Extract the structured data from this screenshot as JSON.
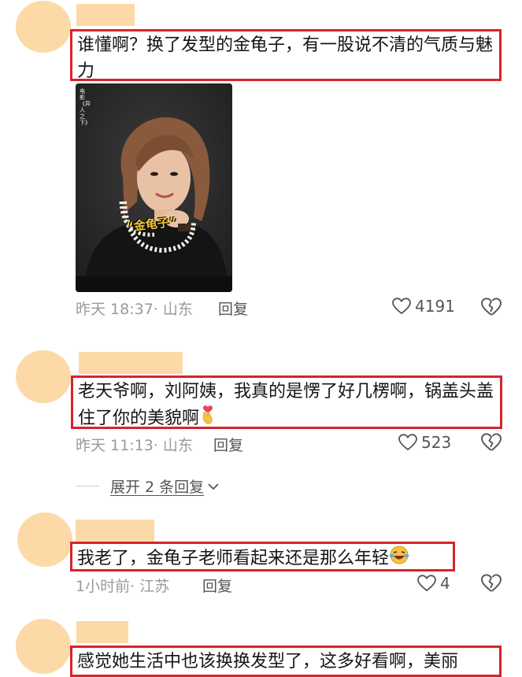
{
  "comments": [
    {
      "text": "谁懂啊？换了发型的金龟子，有一股说不清的气质与魅力",
      "time": "昨天 18:37",
      "location": "山东",
      "reply_label": "回复",
      "likes": "4191",
      "image": {
        "caption": "“金龟子”",
        "vertical_text": "电影《异人之下》"
      }
    },
    {
      "text": "老天爷啊，刘阿姨，我真的是愣了好几楞啊，锅盖头盖住了你的美貌啊",
      "time": "昨天 11:13",
      "location": "山东",
      "reply_label": "回复",
      "likes": "523",
      "expand_label": "展开 2 条回复"
    },
    {
      "text": "我老了，金龟子老师看起来还是那么年轻",
      "time": "1小时前",
      "location": "江苏",
      "reply_label": "回复",
      "likes": "4"
    },
    {
      "text": "感觉她生活中也该换换发型了，这多好看啊，美丽"
    }
  ],
  "icons": {
    "like": "heart-outline-icon",
    "dislike": "broken-heart-icon",
    "expand": "chevron-down-icon",
    "emoji_2": "heart-hands-emoji",
    "emoji_3": "laughing-tears-emoji"
  },
  "colors": {
    "highlight_border": "#d8232a",
    "avatar": "#fcd9a6",
    "meta_text": "#9a9a9a"
  }
}
